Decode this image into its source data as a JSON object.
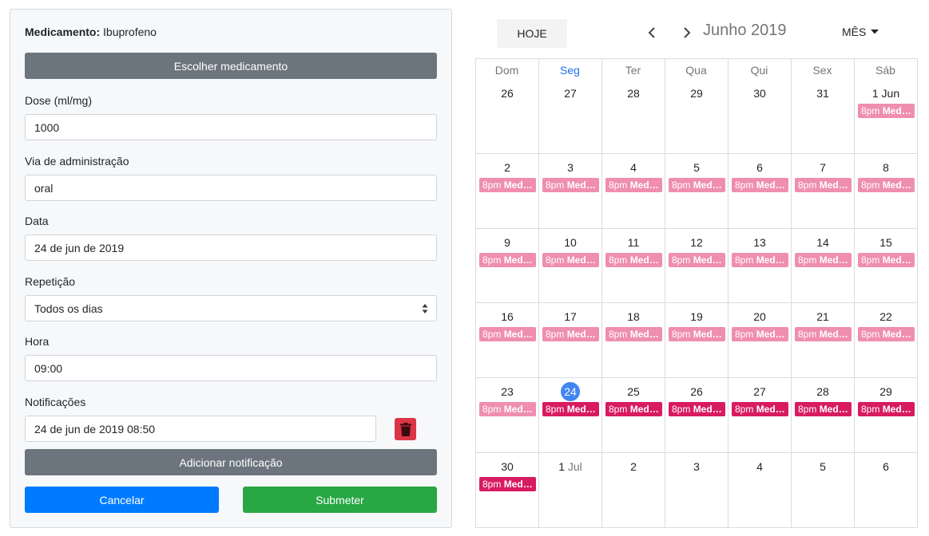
{
  "form": {
    "medication_label": "Medicamento:",
    "medication_value": "Ibuprofeno",
    "choose_medication": "Escolher medicamento",
    "dose_label": "Dose (ml/mg)",
    "dose_value": "1000",
    "route_label": "Via de administração",
    "route_value": "oral",
    "date_label": "Data",
    "date_value": "24 de jun de 2019",
    "repeat_label": "Repetição",
    "repeat_value": "Todos os dias",
    "time_label": "Hora",
    "time_value": "09:00",
    "notifications_label": "Notificações",
    "notification_value": "24 de jun de 2019 08:50",
    "add_notification": "Adicionar notificação",
    "cancel": "Cancelar",
    "submit": "Submeter"
  },
  "calendar": {
    "today_button": "HOJE",
    "title": "Junho 2019",
    "view_button": "MÊS",
    "weekdays": [
      "Dom",
      "Seg",
      "Ter",
      "Qua",
      "Qui",
      "Sex",
      "Sáb"
    ],
    "event_time": "8pm",
    "event_title": "Med…",
    "weeks": [
      [
        {
          "d": "26"
        },
        {
          "d": "27"
        },
        {
          "d": "28"
        },
        {
          "d": "29"
        },
        {
          "d": "30"
        },
        {
          "d": "31"
        },
        {
          "d": "1 Jun",
          "ev": "past"
        }
      ],
      [
        {
          "d": "2",
          "ev": "past"
        },
        {
          "d": "3",
          "ev": "past"
        },
        {
          "d": "4",
          "ev": "past"
        },
        {
          "d": "5",
          "ev": "past"
        },
        {
          "d": "6",
          "ev": "past"
        },
        {
          "d": "7",
          "ev": "past"
        },
        {
          "d": "8",
          "ev": "past"
        }
      ],
      [
        {
          "d": "9",
          "ev": "past"
        },
        {
          "d": "10",
          "ev": "past"
        },
        {
          "d": "11",
          "ev": "past"
        },
        {
          "d": "12",
          "ev": "past"
        },
        {
          "d": "13",
          "ev": "past"
        },
        {
          "d": "14",
          "ev": "past"
        },
        {
          "d": "15",
          "ev": "past"
        }
      ],
      [
        {
          "d": "16",
          "ev": "past"
        },
        {
          "d": "17",
          "ev": "past"
        },
        {
          "d": "18",
          "ev": "past"
        },
        {
          "d": "19",
          "ev": "past"
        },
        {
          "d": "20",
          "ev": "past"
        },
        {
          "d": "21",
          "ev": "past"
        },
        {
          "d": "22",
          "ev": "past"
        }
      ],
      [
        {
          "d": "23",
          "ev": "past"
        },
        {
          "d": "24",
          "ev": "future",
          "today": true
        },
        {
          "d": "25",
          "ev": "future"
        },
        {
          "d": "26",
          "ev": "future"
        },
        {
          "d": "27",
          "ev": "future"
        },
        {
          "d": "28",
          "ev": "future"
        },
        {
          "d": "29",
          "ev": "future"
        }
      ],
      [
        {
          "d": "30",
          "ev": "future"
        },
        {
          "d": "1",
          "m": "Jul",
          "other": true
        },
        {
          "d": "2"
        },
        {
          "d": "3"
        },
        {
          "d": "4"
        },
        {
          "d": "5"
        },
        {
          "d": "6"
        }
      ]
    ]
  },
  "colors": {
    "past_event": "#ef8eb0",
    "future_event": "#d81b60",
    "today": "#4285f4"
  }
}
